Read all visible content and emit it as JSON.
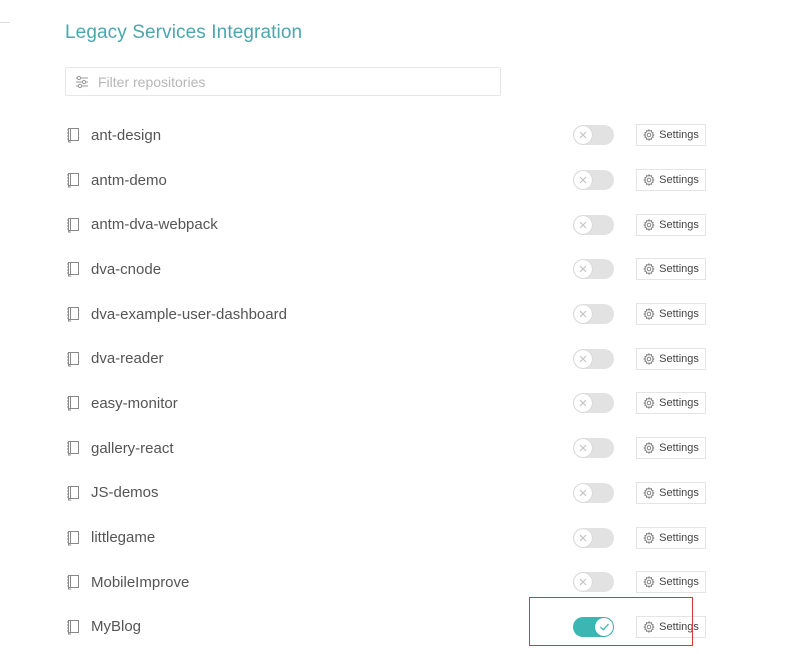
{
  "page": {
    "title": "Legacy Services Integration"
  },
  "filter": {
    "placeholder": "Filter repositories",
    "value": ""
  },
  "repos": [
    {
      "name": "ant-design",
      "enabled": false,
      "settings_label": "Settings"
    },
    {
      "name": "antm-demo",
      "enabled": false,
      "settings_label": "Settings"
    },
    {
      "name": "antm-dva-webpack",
      "enabled": false,
      "settings_label": "Settings"
    },
    {
      "name": "dva-cnode",
      "enabled": false,
      "settings_label": "Settings"
    },
    {
      "name": "dva-example-user-dashboard",
      "enabled": false,
      "settings_label": "Settings"
    },
    {
      "name": "dva-reader",
      "enabled": false,
      "settings_label": "Settings"
    },
    {
      "name": "easy-monitor",
      "enabled": false,
      "settings_label": "Settings"
    },
    {
      "name": "gallery-react",
      "enabled": false,
      "settings_label": "Settings"
    },
    {
      "name": "JS-demos",
      "enabled": false,
      "settings_label": "Settings"
    },
    {
      "name": "littlegame",
      "enabled": false,
      "settings_label": "Settings"
    },
    {
      "name": "MobileImprove",
      "enabled": false,
      "settings_label": "Settings"
    },
    {
      "name": "MyBlog",
      "enabled": true,
      "settings_label": "Settings"
    }
  ],
  "colors": {
    "accent": "#4aa8ad",
    "toggle_on": "#3bb6b2",
    "toggle_off": "#e2e2e2",
    "highlight": "#d9363e"
  },
  "icons": {
    "filter": "sliders-icon",
    "repo": "book-icon",
    "toggle_off": "x-icon",
    "toggle_on": "check-icon",
    "settings": "gear-icon"
  }
}
